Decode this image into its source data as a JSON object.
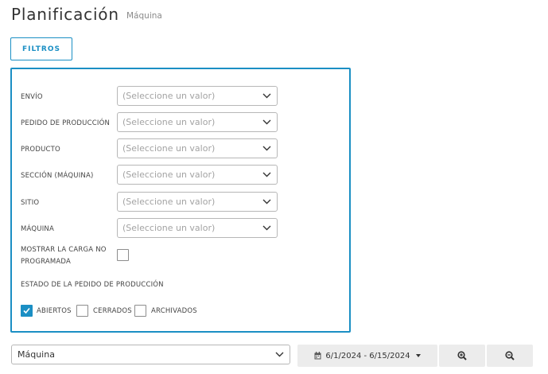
{
  "header": {
    "title": "Planificación",
    "subtitle": "Máquina"
  },
  "toolbar": {
    "filters_label": "FILTROS"
  },
  "filters": {
    "fields": [
      {
        "label": "ENVÍO",
        "placeholder": "(Seleccione un valor)"
      },
      {
        "label": "PEDIDO DE PRODUCCIÓN",
        "placeholder": "(Seleccione un valor)"
      },
      {
        "label": "PRODUCTO",
        "placeholder": "(Seleccione un valor)"
      },
      {
        "label": "SECCIÓN (MÁQUINA)",
        "placeholder": "(Seleccione un valor)"
      },
      {
        "label": "SITIO",
        "placeholder": "(Seleccione un valor)"
      },
      {
        "label": "MÁQUINA",
        "placeholder": "(Seleccione un valor)"
      }
    ],
    "unscheduled": {
      "label_line1": "MOSTRAR LA CARGA NO",
      "label_line2": "PROGRAMADA",
      "checked": false
    },
    "order_state": {
      "title": "ESTADO DE LA PEDIDO DE PRODUCCIÓN",
      "options": [
        {
          "label": "ABIERTOS",
          "checked": true
        },
        {
          "label": "CERRADOS",
          "checked": false
        },
        {
          "label": "ARCHIVADOS",
          "checked": false
        }
      ]
    }
  },
  "bottom_bar": {
    "view_select_value": "Máquina",
    "date_range": "6/1/2024 - 6/15/2024"
  },
  "colors": {
    "accent": "#1b8fc4",
    "button_bg": "#ececec",
    "border": "#b7b7b7"
  },
  "icons": [
    "chevron-down-icon",
    "check-icon",
    "calendar-icon",
    "caret-down-icon",
    "zoom-in-icon",
    "zoom-out-icon"
  ]
}
